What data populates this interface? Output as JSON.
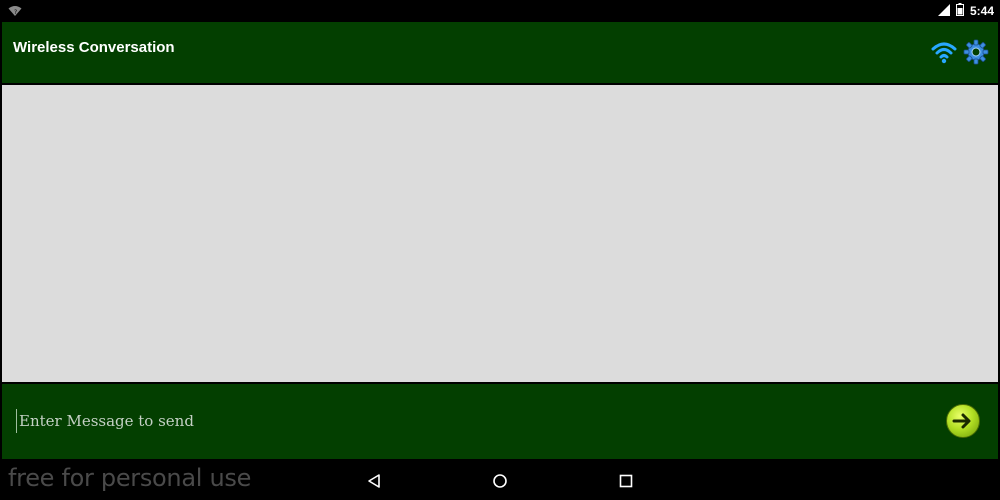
{
  "status_bar": {
    "time": "5:44",
    "icons": [
      "wifi-icon",
      "signal-icon",
      "battery-icon"
    ]
  },
  "app_bar": {
    "title": "Wireless Conversation",
    "actions": [
      "wifi-icon",
      "gear-icon"
    ],
    "color": "#033f00"
  },
  "conversation": {
    "background": "#dcdcdc"
  },
  "composer": {
    "placeholder": "Enter Message to send",
    "value": "",
    "send_icon": "arrow-right-icon"
  },
  "nav_bar": {
    "watermark": "free for personal use",
    "buttons": [
      "back-icon",
      "home-icon",
      "recents-icon"
    ]
  }
}
